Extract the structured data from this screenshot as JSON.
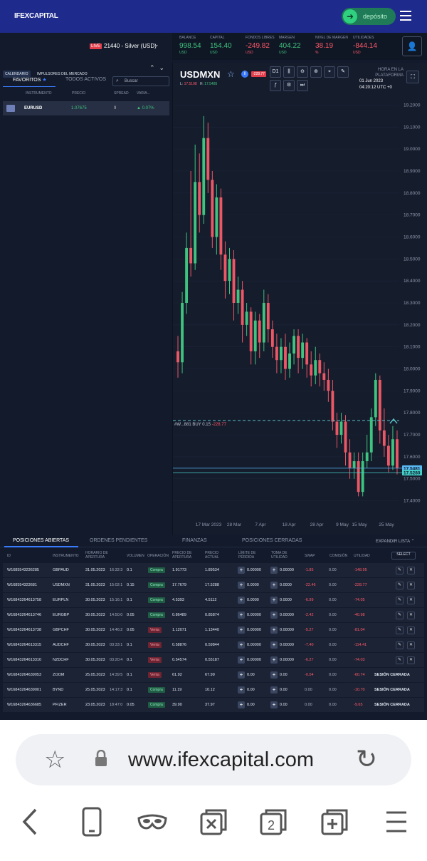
{
  "header": {
    "brand": "IFEXCAPITAL",
    "deposit_label": "depósito"
  },
  "account": {
    "live_badge": "LIVE",
    "account_name": "21440 - Silver (USD)",
    "stats": [
      {
        "label": "BALANCE",
        "value": "998.54",
        "unit": "USD",
        "color": "#41c37d"
      },
      {
        "label": "CAPITAL",
        "value": "154.40",
        "unit": "USD",
        "color": "#41c37d"
      },
      {
        "label": "FONDOS LIBRES",
        "value": "-249.82",
        "unit": "USD",
        "color": "#ff5a68"
      },
      {
        "label": "MARGEN",
        "value": "404.22",
        "unit": "USD",
        "color": "#41c37d"
      },
      {
        "label": "NIVEL DE MARGEN",
        "value": "38.19",
        "unit": "%",
        "color": "#ff5a68"
      },
      {
        "label": "UTILIDADES",
        "value": "-844.14",
        "unit": "USD",
        "color": "#ff5a68"
      }
    ]
  },
  "left": {
    "chips": [
      "CALENDARIO",
      "IMPULSORES DEL MERCADO"
    ],
    "tab_favorites": "FAVORITOS",
    "tab_all": "TODOS ACTIVOS",
    "search_placeholder": "Buscar",
    "columns": [
      "INSTRUMENTO",
      "PRECIO",
      "SPREAD",
      "VARIA..."
    ],
    "row": {
      "symbol": "EURUSD",
      "price": "1.07675",
      "spread": "9",
      "variation": "0.07%"
    }
  },
  "chart_header": {
    "symbol": "USDMXN",
    "pnl_badge": "-228.77",
    "low_label": "L:",
    "low_value": "17.5198",
    "high_label": "H:",
    "high_value": "17.5485",
    "timeframe": "D1",
    "platform_time_label": "HORA EN LA PLATAFORMA",
    "date": "01 Jun 2023",
    "clock": "04:20:12 UTC +0"
  },
  "chart_data": {
    "type": "candlestick",
    "symbol": "USDMXN",
    "timeframe": "D1",
    "y_ticks": [
      "19.2000",
      "19.1000",
      "19.0000",
      "18.9000",
      "18.8000",
      "18.7000",
      "18.6000",
      "18.5000",
      "18.4000",
      "18.3000",
      "18.2000",
      "18.1000",
      "18.0000",
      "17.9000",
      "17.8000",
      "17.7000",
      "17.6000",
      "17.5000",
      "17.4000"
    ],
    "x_ticks": [
      "17 Mar 2023",
      "28 Mar",
      "7 Apr",
      "18 Apr",
      "28 Apr",
      "9 May",
      "15 May",
      "25 May"
    ],
    "ylim": [
      17.35,
      19.25
    ],
    "price_tags": [
      "17.5481",
      "17.5280"
    ],
    "position_line": {
      "label": "#W...881 BUY 0.15",
      "pnl": "-228.77",
      "price": 17.765
    },
    "candles": [
      [
        18.08,
        18.03,
        18.15,
        17.96
      ],
      [
        18.03,
        18.3,
        18.35,
        17.98
      ],
      [
        18.3,
        18.55,
        18.62,
        18.25
      ],
      [
        18.55,
        18.48,
        18.9,
        18.42
      ],
      [
        18.48,
        18.85,
        19.02,
        18.45
      ],
      [
        18.85,
        18.7,
        18.98,
        18.62
      ],
      [
        18.7,
        19.05,
        19.15,
        18.66
      ],
      [
        19.05,
        18.86,
        19.12,
        18.8
      ],
      [
        18.86,
        18.6,
        18.9,
        18.55
      ],
      [
        18.6,
        18.78,
        18.84,
        18.52
      ],
      [
        18.78,
        18.52,
        18.82,
        18.45
      ],
      [
        18.52,
        18.4,
        18.58,
        18.32
      ],
      [
        18.4,
        18.5,
        18.55,
        18.34
      ],
      [
        18.5,
        18.3,
        18.54,
        18.22
      ],
      [
        18.3,
        18.36,
        18.42,
        18.25
      ],
      [
        18.36,
        18.2,
        18.4,
        18.12
      ],
      [
        18.2,
        18.26,
        18.3,
        18.15
      ],
      [
        18.26,
        18.08,
        18.28,
        18.02
      ],
      [
        18.08,
        18.22,
        18.26,
        18.02
      ],
      [
        18.22,
        18.12,
        18.25,
        18.05
      ],
      [
        18.12,
        18.3,
        18.36,
        18.08
      ],
      [
        18.3,
        18.18,
        18.34,
        18.12
      ],
      [
        18.18,
        18.1,
        18.22,
        18.05
      ],
      [
        18.1,
        18.04,
        18.16,
        17.98
      ],
      [
        18.04,
        18.1,
        18.14,
        17.98
      ],
      [
        18.1,
        18.0,
        18.16,
        17.95
      ],
      [
        18.0,
        18.07,
        18.12,
        17.96
      ],
      [
        18.07,
        18.15,
        18.18,
        18.02
      ],
      [
        18.15,
        18.05,
        18.18,
        17.98
      ],
      [
        18.05,
        18.12,
        18.16,
        18.0
      ],
      [
        18.12,
        18.02,
        18.14,
        17.96
      ],
      [
        18.02,
        17.97,
        18.08,
        17.92
      ],
      [
        17.97,
        18.04,
        18.1,
        17.93
      ],
      [
        18.04,
        17.98,
        18.07,
        17.92
      ],
      [
        17.98,
        17.95,
        18.03,
        17.9
      ],
      [
        17.95,
        17.9,
        18.0,
        17.85
      ],
      [
        17.9,
        17.76,
        17.95,
        17.72
      ],
      [
        17.76,
        17.7,
        17.8,
        17.64
      ],
      [
        17.7,
        17.76,
        17.8,
        17.66
      ],
      [
        17.76,
        17.62,
        17.79,
        17.56
      ],
      [
        17.62,
        17.55,
        17.68,
        17.5
      ],
      [
        17.55,
        17.58,
        17.62,
        17.5
      ],
      [
        17.58,
        17.44,
        17.62,
        17.42
      ],
      [
        17.44,
        17.58,
        17.62,
        17.42
      ],
      [
        17.58,
        17.62,
        17.7,
        17.55
      ],
      [
        17.62,
        17.78,
        17.82,
        17.58
      ],
      [
        17.78,
        17.95,
        17.98,
        17.74
      ],
      [
        17.95,
        17.72,
        17.97,
        17.66
      ],
      [
        17.72,
        17.65,
        17.82,
        17.6
      ],
      [
        17.65,
        17.56,
        17.7,
        17.53
      ],
      [
        17.56,
        17.68,
        17.74,
        17.54
      ],
      [
        17.68,
        17.55,
        17.72,
        17.52
      ]
    ]
  },
  "bottom": {
    "tabs": [
      "POSICIONES ABIERTAS",
      "ORDENES PENDIENTES",
      "FINANZAS",
      "POSICIONES CERRADAS"
    ],
    "expand_label": "EXPANDIR LISTA",
    "columns": [
      "ID",
      "INSTRUMENTO",
      "HORARIO DE APERTURA",
      "VOLUMEN",
      "OPERACIÓN",
      "PRECIO DE APERTURA",
      "PRECIO ACTUAL",
      "LÍMITE DE PÉRDIDA",
      "TOMA DE UTILIDAD",
      "SWAP",
      "COMISIÓN",
      "UTILIDAD"
    ],
    "select_label": "SELECT",
    "rows": [
      {
        "id": "W168554323628​5",
        "sym": "GBPAUD",
        "date": "31.05.2023",
        "time": "16:32:3",
        "vol": "0.1",
        "op": "Compra",
        "open": "1.91773",
        "cur": "1.89534",
        "sl": "0.00000",
        "tp": "0.00000",
        "swap": "-1.85",
        "comm": "0.00",
        "profit": "-148.95",
        "closed": ""
      },
      {
        "id": "W16855432368​1",
        "sym": "USDMXN",
        "date": "31.05.2023",
        "time": "15:02:1",
        "vol": "0.15",
        "op": "Compra",
        "open": "17.7679",
        "cur": "17.5288",
        "sl": "0.0000",
        "tp": "0.0000",
        "swap": "-22.46",
        "comm": "0.00",
        "profit": "-228.77",
        "closed": ""
      },
      {
        "id": "W1684326461375​8",
        "sym": "EURPLN",
        "date": "30.05.2023",
        "time": "15:16:1",
        "vol": "0.1",
        "op": "Compra",
        "open": "4.5393",
        "cur": "4.5112",
        "sl": "0.0000",
        "tp": "0.0000",
        "swap": "-6.99",
        "comm": "0.00",
        "profit": "-74.05",
        "closed": ""
      },
      {
        "id": "W1684326461374​6",
        "sym": "EURGBP",
        "date": "30.05.2023",
        "time": "14:50:0",
        "vol": "0.05",
        "op": "Compra",
        "open": "0.86489",
        "cur": "0.85874",
        "sl": "0.00000",
        "tp": "0.00000",
        "swap": "-2.42",
        "comm": "0.00",
        "profit": "-40.98",
        "closed": ""
      },
      {
        "id": "W1684326461373​8",
        "sym": "GBPCHF",
        "date": "30.05.2023",
        "time": "14:46:2",
        "vol": "0.05",
        "op": "Venta",
        "open": "1.12071",
        "cur": "1.13440",
        "sl": "0.00000",
        "tp": "0.00000",
        "swap": "-5.27",
        "comm": "0.00",
        "profit": "-81.04",
        "closed": ""
      },
      {
        "id": "W1684326461331​5",
        "sym": "AUDCHF",
        "date": "30.05.2023",
        "time": "03:33:1",
        "vol": "0.1",
        "op": "Venta",
        "open": "0.58876",
        "cur": "0.59844",
        "sl": "0.00000",
        "tp": "0.00000",
        "swap": "-7.40",
        "comm": "0.00",
        "profit": "-114.41",
        "closed": ""
      },
      {
        "id": "W1684326461331​0",
        "sym": "NZDCHF",
        "date": "30.05.2023",
        "time": "03:20:4",
        "vol": "0.1",
        "op": "Venta",
        "open": "0.54574",
        "cur": "0.55187",
        "sl": "0.00000",
        "tp": "0.00000",
        "swap": "-6.27",
        "comm": "0.00",
        "profit": "-74.03",
        "closed": ""
      },
      {
        "id": "W168432646390​53",
        "sym": "ZOOM",
        "date": "25.05.2023",
        "time": "14:39:5",
        "vol": "0.1",
        "op": "Venta",
        "open": "61.92",
        "cur": "67.99",
        "sl": "0.00",
        "tp": "0.00",
        "swap": "-0.04",
        "comm": "0.00",
        "profit": "-60.74",
        "closed": "SESIÓN CERRADA"
      },
      {
        "id": "W168432646390​01",
        "sym": "BYND",
        "date": "25.05.2023",
        "time": "14:17:3",
        "vol": "0.1",
        "op": "Compra",
        "open": "11.19",
        "cur": "10.12",
        "sl": "0.00",
        "tp": "0.00",
        "swap": "0.00",
        "comm": "0.00",
        "profit": "-10.70",
        "closed": "SESIÓN CERRADA"
      },
      {
        "id": "W168432646366​85",
        "sym": "PFIZER",
        "date": "23.05.2023",
        "time": "18:47:0",
        "vol": "0.05",
        "op": "Compra",
        "open": "39.90",
        "cur": "37.97",
        "sl": "0.00",
        "tp": "0.00",
        "swap": "0.00",
        "comm": "0.00",
        "profit": "-9.65",
        "closed": "SESIÓN CERRADA"
      }
    ]
  },
  "browser": {
    "url": "www.ifexcapital.com",
    "tabs_count": "2"
  },
  "colors": {
    "up": "#3fc47f",
    "down": "#ec5766",
    "accent": "#3a7bfd",
    "header": "#1f2b8c"
  }
}
